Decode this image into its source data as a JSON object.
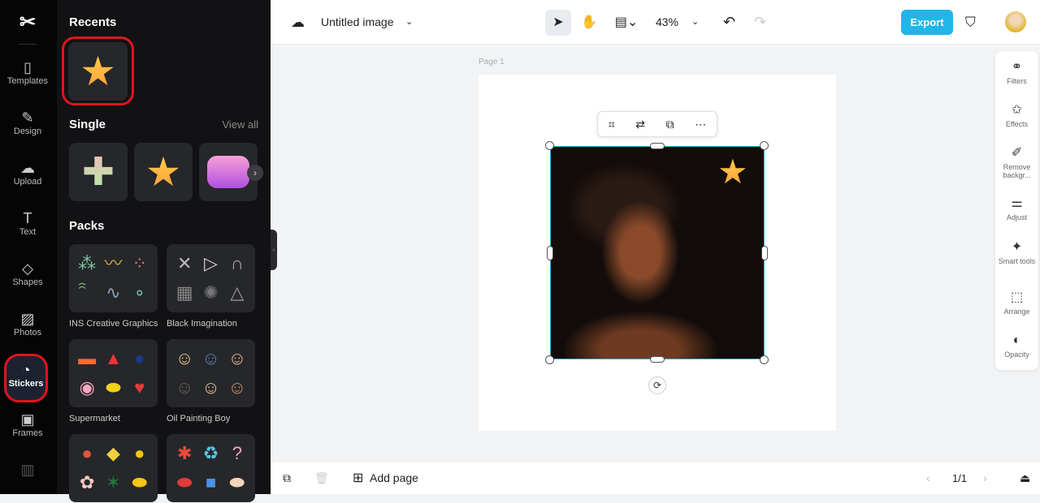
{
  "rail": {
    "items": [
      {
        "label": "Templates",
        "icon": "▯"
      },
      {
        "label": "Design",
        "icon": "✎"
      },
      {
        "label": "Upload",
        "icon": "☁"
      },
      {
        "label": "Text",
        "icon": "T"
      },
      {
        "label": "Shapes",
        "icon": "◇"
      },
      {
        "label": "Photos",
        "icon": "▨"
      },
      {
        "label": "Stickers",
        "icon": "◔"
      },
      {
        "label": "Frames",
        "icon": "▣"
      }
    ],
    "active": "Stickers"
  },
  "panel": {
    "recents_title": "Recents",
    "single_title": "Single",
    "view_all": "View all",
    "packs_title": "Packs",
    "packs": [
      {
        "label": "INS Creative Graphics",
        "items": [
          [
            "⁂",
            "#7fc9a8"
          ],
          [
            "〰",
            "#d4b23a"
          ],
          [
            "⁘",
            "#e0776b"
          ],
          [
            "ꩰ",
            "#8fbf7a"
          ],
          [
            "∿",
            "#8aa0b0"
          ],
          [
            "∘",
            "#6fc3b9"
          ]
        ]
      },
      {
        "label": "Black Imagination",
        "items": [
          [
            "✕",
            "#bbb"
          ],
          [
            "▷",
            "#ccc"
          ],
          [
            "∩",
            "#aaa"
          ],
          [
            "▦",
            "#888"
          ],
          [
            "✺",
            "#777"
          ],
          [
            "△",
            "#999"
          ]
        ]
      },
      {
        "label": "Supermarket",
        "items": [
          [
            "▬",
            "#ff6a2a"
          ],
          [
            "▲",
            "#e33"
          ],
          [
            "●",
            "#1a3a8a"
          ],
          [
            "◉",
            "#f7a7c0"
          ],
          [
            "⬬",
            "#f3d21a"
          ],
          [
            "♥",
            "#e33b3b"
          ]
        ]
      },
      {
        "label": "Oil Painting Boy",
        "items": [
          [
            "☺",
            "#f0c58a"
          ],
          [
            "☺",
            "#5a7fb0"
          ],
          [
            "☺",
            "#e8b990"
          ],
          [
            "☺",
            "#6a5a50"
          ],
          [
            "☺",
            "#e8c090"
          ],
          [
            "☺",
            "#c89060"
          ]
        ]
      },
      {
        "label": "",
        "items": [
          [
            "●",
            "#e2563a"
          ],
          [
            "◆",
            "#f0d040"
          ],
          [
            "●",
            "#f5c518"
          ],
          [
            "✿",
            "#f9c7c0"
          ],
          [
            "✶",
            "#1e7a3a"
          ],
          [
            "⬬",
            "#f5c518"
          ]
        ]
      },
      {
        "label": "",
        "items": [
          [
            "✱",
            "#f04a3a"
          ],
          [
            "♻",
            "#5ac8e8"
          ],
          [
            "?",
            "#f0a8b0"
          ],
          [
            "⬬",
            "#e03a3a"
          ],
          [
            "■",
            "#4a90e8"
          ],
          [
            "⬬",
            "#f6d6b8"
          ]
        ]
      }
    ]
  },
  "header": {
    "title": "Untitled image",
    "zoom": "43%",
    "export": "Export"
  },
  "canvas": {
    "page_label": "Page 1"
  },
  "right_tools": [
    {
      "label": "Filters",
      "icon": "⚭"
    },
    {
      "label": "Effects",
      "icon": "✩"
    },
    {
      "label": "Remove backgr...",
      "icon": "✐"
    },
    {
      "label": "Adjust",
      "icon": "⚌"
    },
    {
      "label": "Smart tools",
      "icon": "✦"
    },
    {
      "label": "Arrange",
      "icon": "⬚"
    },
    {
      "label": "Opacity",
      "icon": "◐"
    }
  ],
  "footer": {
    "add_page": "Add page",
    "page_count": "1/1"
  },
  "colors": {
    "accent": "#22b5e8",
    "selection": "#29b6d8",
    "highlight": "#e0141e"
  }
}
